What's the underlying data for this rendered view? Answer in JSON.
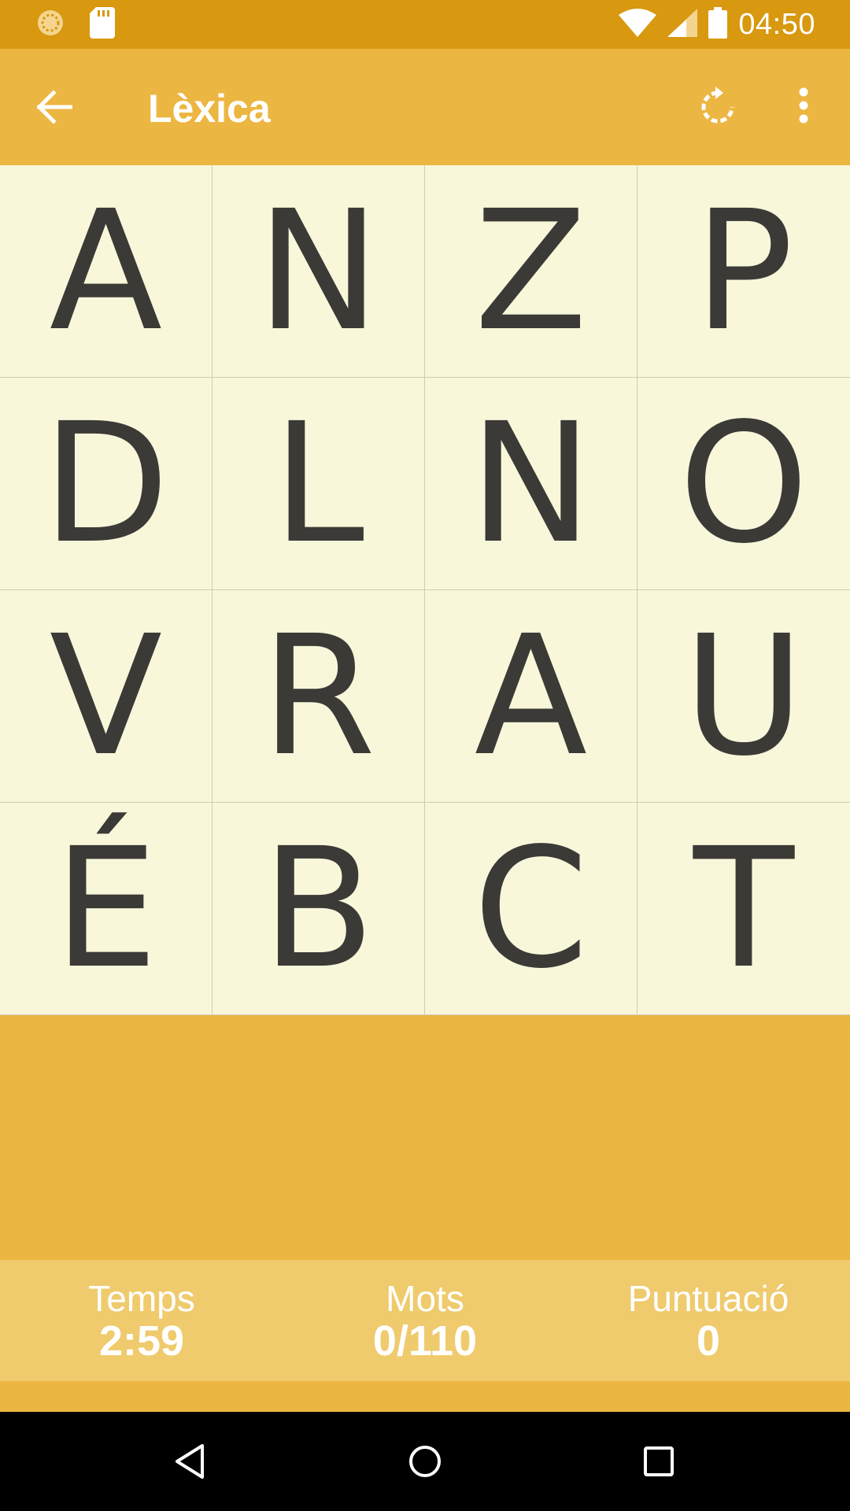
{
  "status_bar": {
    "time": "04:50",
    "icons": [
      "loading-circle-icon",
      "sd-card-icon",
      "wifi-icon",
      "signal-icon",
      "battery-icon"
    ]
  },
  "app_bar": {
    "title": "Lèxica",
    "icons": [
      "back-arrow-icon",
      "refresh-icon",
      "more-vert-icon"
    ]
  },
  "board": {
    "letters": [
      "A",
      "N",
      "Z",
      "P",
      "D",
      "L",
      "N",
      "O",
      "V",
      "R",
      "A",
      "U",
      "É",
      "B",
      "C",
      "T"
    ]
  },
  "stats": {
    "time_label": "Temps",
    "time_value": "2:59",
    "words_label": "Mots",
    "words_value": "0/110",
    "score_label": "Puntuació",
    "score_value": "0"
  },
  "nav_bar": {
    "icons": [
      "back-triangle-icon",
      "home-circle-icon",
      "recents-square-icon"
    ]
  },
  "colors": {
    "status_bar": "#D8980F",
    "primary": "#ECB642",
    "stats_bar": "#EFCB6D",
    "tile_bg": "#F8F7DA",
    "letter": "#3C3A37"
  }
}
